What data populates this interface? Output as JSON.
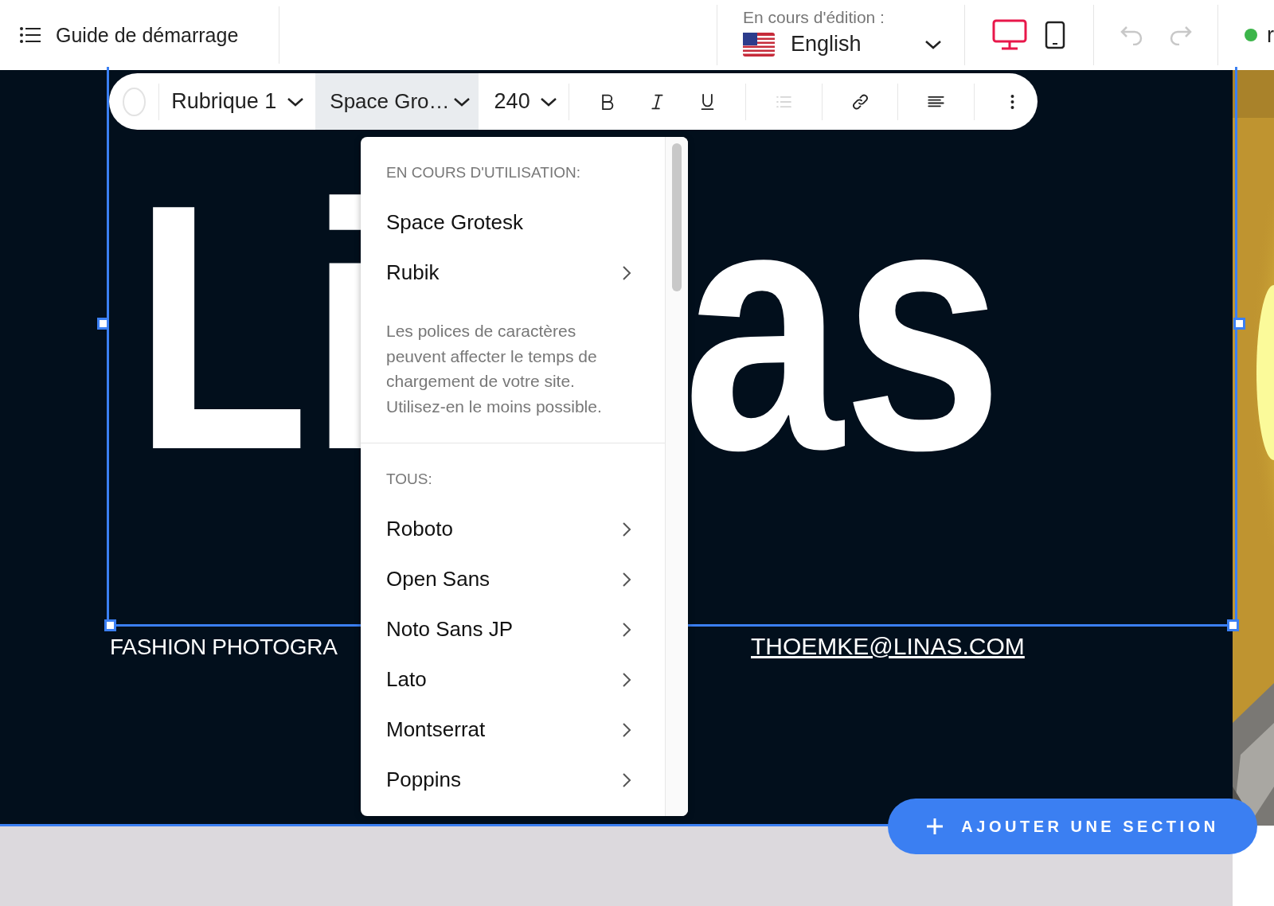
{
  "top_bar": {
    "guide_label": "Guide de démarrage",
    "editing_label": "En cours d'édition :",
    "language": "English",
    "devices": [
      {
        "kind": "desktop",
        "selected": true
      },
      {
        "kind": "mobile",
        "selected": false
      }
    ],
    "history": [
      {
        "kind": "undo",
        "disabled": true
      },
      {
        "kind": "redo",
        "disabled": true
      }
    ],
    "status_text": "r"
  },
  "toolbar": {
    "style": "Rubrique 1",
    "font": "Space Gro…",
    "size": "240",
    "buttons": [
      {
        "kind": "bold",
        "disabled": false
      },
      {
        "kind": "italic",
        "disabled": false
      },
      {
        "kind": "underline",
        "disabled": false
      },
      {
        "kind": "list",
        "disabled": true
      },
      {
        "kind": "link",
        "disabled": false
      },
      {
        "kind": "align",
        "disabled": false
      },
      {
        "kind": "more",
        "disabled": false
      }
    ]
  },
  "font_menu": {
    "in_use_heading": "EN COURS D'UTILISATION:",
    "in_use": [
      {
        "name": "Space Grotesk",
        "submenu": false
      },
      {
        "name": "Rubik",
        "submenu": true
      }
    ],
    "note": "Les polices de caractères peuvent affecter le temps de chargement de votre site. Utilisez-en le moins possible.",
    "all_heading": "TOUS:",
    "all": [
      {
        "name": "Roboto",
        "submenu": true
      },
      {
        "name": "Open Sans",
        "submenu": true
      },
      {
        "name": "Noto Sans JP",
        "submenu": true
      },
      {
        "name": "Lato",
        "submenu": true
      },
      {
        "name": "Montserrat",
        "submenu": true
      },
      {
        "name": "Poppins",
        "submenu": true
      }
    ]
  },
  "page": {
    "heading_parts": [
      "Li",
      "as"
    ],
    "subtitle": "FASHION PHOTOGRA",
    "email": "THOEMKE@LINAS.COM"
  },
  "add_section_button": "AJOUTER UNE SECTION"
}
